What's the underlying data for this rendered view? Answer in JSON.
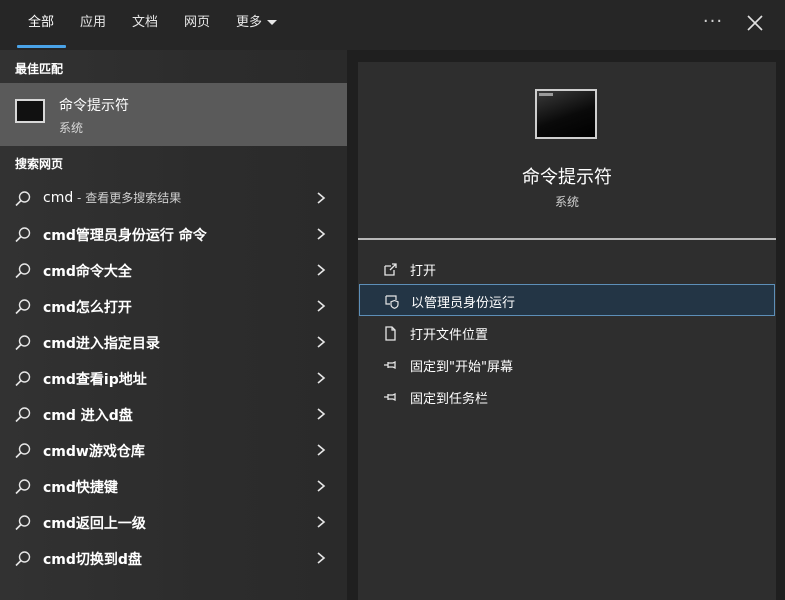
{
  "tabs": [
    {
      "label": "全部",
      "active": true
    },
    {
      "label": "应用"
    },
    {
      "label": "文档"
    },
    {
      "label": "网页"
    },
    {
      "label": "更多"
    }
  ],
  "window_controls": {
    "more": "···"
  },
  "best_match": {
    "section_title": "最佳匹配",
    "title": "命令提示符",
    "subtitle": "系统"
  },
  "web_search": {
    "section_title": "搜索网页",
    "results": [
      {
        "query": "cmd",
        "suffix": " - 查看更多搜索结果"
      },
      {
        "query": "cmd管理员身份运行 命令"
      },
      {
        "query": "cmd命令大全"
      },
      {
        "query": "cmd怎么打开"
      },
      {
        "query": "cmd进入指定目录"
      },
      {
        "query": "cmd查看ip地址"
      },
      {
        "query": "cmd 进入d盘"
      },
      {
        "query": "cmdw游戏仓库"
      },
      {
        "query": "cmd快捷键"
      },
      {
        "query": "cmd返回上一级"
      },
      {
        "query": "cmd切换到d盘"
      }
    ]
  },
  "detail": {
    "app_name": "命令提示符",
    "app_type": "系统",
    "actions": [
      {
        "label": "打开",
        "icon": "open-icon"
      },
      {
        "label": "以管理员身份运行",
        "icon": "shield-icon",
        "highlighted": true
      },
      {
        "label": "打开文件位置",
        "icon": "file-icon"
      },
      {
        "label": "固定到\"开始\"屏幕",
        "icon": "pin-icon"
      },
      {
        "label": "固定到任务栏",
        "icon": "pin-icon"
      }
    ]
  },
  "colors": {
    "accent": "#4aa3e8",
    "highlight_bg": "#233545",
    "highlight_border": "#5d8fb8"
  }
}
